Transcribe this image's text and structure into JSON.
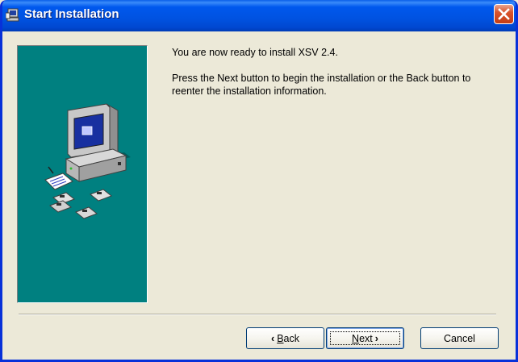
{
  "window": {
    "title": "Start Installation",
    "close_symbol": "✕"
  },
  "main": {
    "ready_message": "You are now ready to install XSV 2.4.",
    "instruction_message": "Press the Next button to begin the installation or the Back button to reenter the installation information."
  },
  "buttons": {
    "back_arrow": "‹",
    "back_mnemonic": "B",
    "back_rest": "ack",
    "next_mnemonic": "N",
    "next_rest": "ext",
    "next_arrow": "›",
    "cancel_label": "Cancel"
  },
  "colors": {
    "title_bar": "#0054E3",
    "panel": "#008080",
    "dialog": "#ECE9D8",
    "close_button": "#D9542C"
  },
  "icons": {
    "title": "installer-icon",
    "panel": "computer-with-floppy-disks-illustration"
  }
}
